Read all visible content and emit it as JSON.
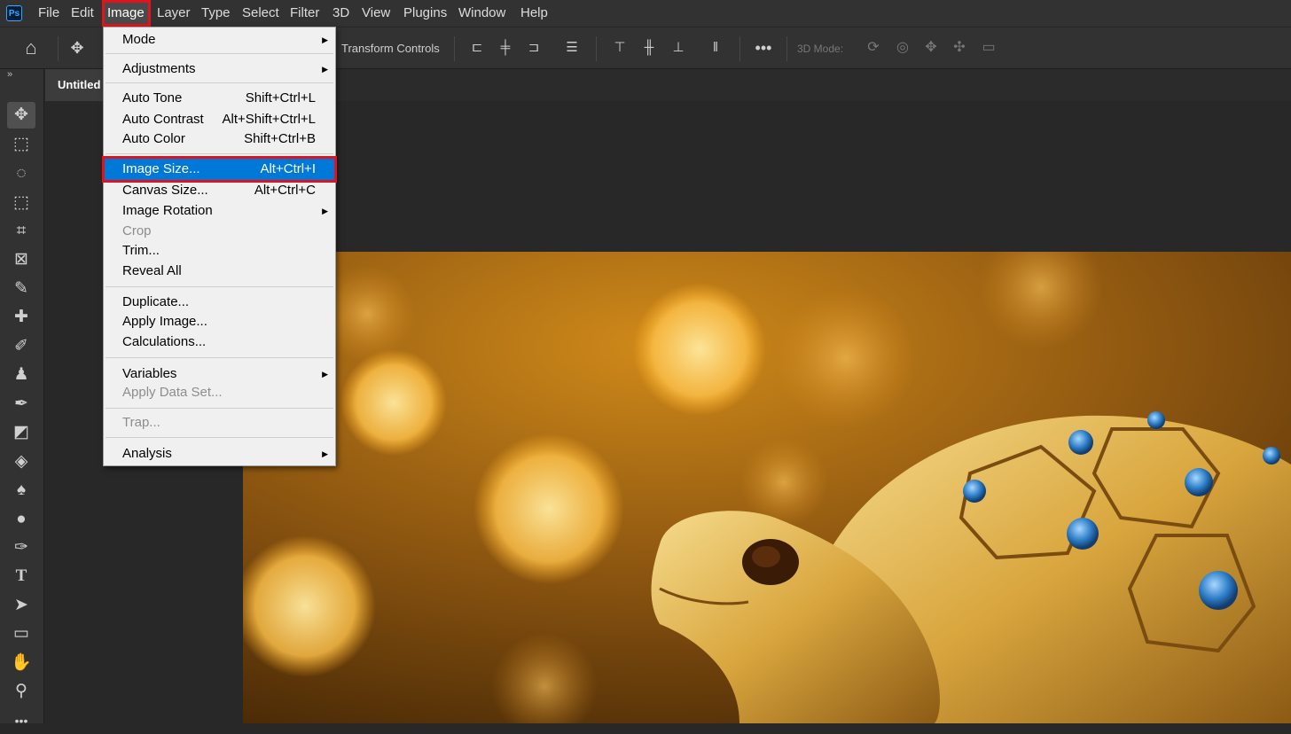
{
  "app": {
    "logo_text": "Ps"
  },
  "menubar": {
    "items": [
      "File",
      "Edit",
      "Image",
      "Layer",
      "Type",
      "Select",
      "Filter",
      "3D",
      "View",
      "Plugins",
      "Window",
      "Help"
    ],
    "active": "Image"
  },
  "options_bar": {
    "transform_controls_label": "Transform Controls",
    "mode_3d_label": "3D Mode:"
  },
  "document": {
    "tab_title": "Untitled"
  },
  "image_menu": {
    "mode": "Mode",
    "adjustments": "Adjustments",
    "auto_tone": "Auto Tone",
    "auto_tone_shortcut": "Shift+Ctrl+L",
    "auto_contrast": "Auto Contrast",
    "auto_contrast_shortcut": "Alt+Shift+Ctrl+L",
    "auto_color": "Auto Color",
    "auto_color_shortcut": "Shift+Ctrl+B",
    "image_size": "Image Size...",
    "image_size_shortcut": "Alt+Ctrl+I",
    "canvas_size": "Canvas Size...",
    "canvas_size_shortcut": "Alt+Ctrl+C",
    "image_rotation": "Image Rotation",
    "crop": "Crop",
    "trim": "Trim...",
    "reveal_all": "Reveal All",
    "duplicate": "Duplicate...",
    "apply_image": "Apply Image...",
    "calculations": "Calculations...",
    "variables": "Variables",
    "apply_data_set": "Apply Data Set...",
    "trap": "Trap...",
    "analysis": "Analysis"
  },
  "colors": {
    "highlight": "#0078d7",
    "annotation": "#e0141e",
    "brand": "#31a8ff"
  }
}
